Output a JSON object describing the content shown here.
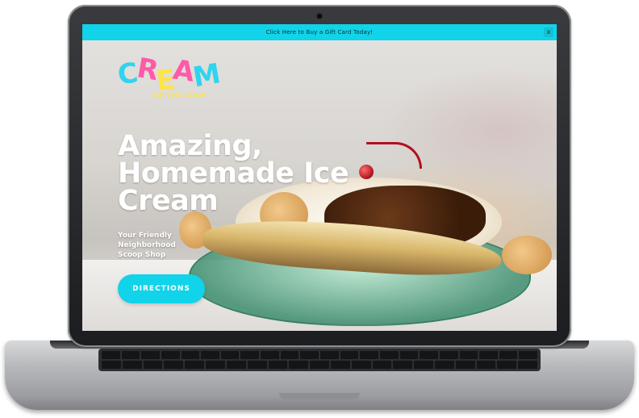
{
  "promo_bar": {
    "text": "Click Here to Buy a Gift Card Today!",
    "close_label": "x",
    "color": "#11d3e9"
  },
  "logo": {
    "letters": [
      "C",
      "R",
      "E",
      "A",
      "M"
    ],
    "letter_colors": [
      "#2fd4ee",
      "#ff5aa8",
      "#ffe34a",
      "#ff5aa8",
      "#2fd4ee"
    ],
    "tagline": "OF THE CROP"
  },
  "hero": {
    "headline": "Amazing, Homemade Ice Cream",
    "subheadline": "Your Friendly Neighborhood Scoop Shop",
    "button_label": "DIRECTIONS"
  },
  "accent_color": "#11d3e9"
}
